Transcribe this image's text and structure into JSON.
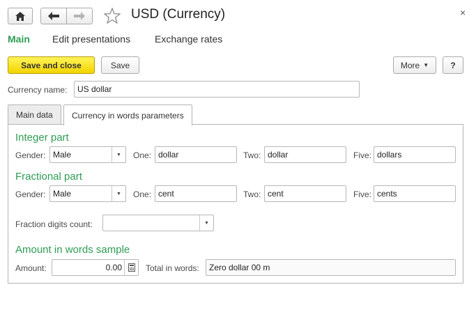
{
  "window": {
    "title": "USD (Currency)",
    "close_glyph": "×"
  },
  "nav": {
    "home_icon": "home-icon",
    "back_icon": "arrow-left-icon",
    "forward_icon": "arrow-right-icon",
    "favorite_icon": "star-icon"
  },
  "panel_tabs": [
    "Main",
    "Edit presentations",
    "Exchange rates"
  ],
  "toolbar": {
    "save_and_close": "Save and close",
    "save": "Save",
    "more": "More",
    "help": "?"
  },
  "currency_name": {
    "label": "Currency name:",
    "value": "US dollar"
  },
  "form_tabs": [
    "Main data",
    "Currency in words parameters"
  ],
  "integer_part": {
    "title": "Integer part",
    "gender_label": "Gender:",
    "gender_value": "Male",
    "one_label": "One:",
    "one_value": "dollar",
    "two_label": "Two:",
    "two_value": "dollar",
    "five_label": "Five:",
    "five_value": "dollars"
  },
  "fractional_part": {
    "title": "Fractional part",
    "gender_label": "Gender:",
    "gender_value": "Male",
    "one_label": "One:",
    "one_value": "cent",
    "two_label": "Two:",
    "two_value": "cent",
    "five_label": "Five:",
    "five_value": "cents"
  },
  "fraction_digits": {
    "label": "Fraction digits count:",
    "value": ""
  },
  "sample": {
    "title": "Amount in words sample",
    "amount_label": "Amount:",
    "amount_value": "0.00",
    "total_label": "Total in words:",
    "total_value": "Zero dollar 00 m"
  },
  "colors": {
    "accent_green": "#2e9c54",
    "primary_button": "#f3d400"
  }
}
